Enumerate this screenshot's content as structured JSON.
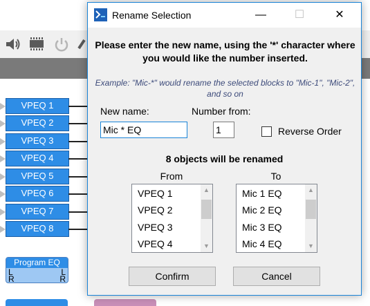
{
  "dialog": {
    "title": "Rename Selection",
    "instruction": "Please enter the new name, using the '*' character where you would like the number inserted.",
    "example": "Example: \"Mic-*\" would rename the selected blocks to \"Mic-1\", \"Mic-2\", and so on",
    "new_name_label": "New name:",
    "new_name_value": "Mic * EQ",
    "number_from_label": "Number from:",
    "number_from_value": "1",
    "reverse_order_label": "Reverse Order",
    "reverse_order_checked": false,
    "count_text": "8 objects will be renamed",
    "from_header": "From",
    "to_header": "To",
    "from_items": [
      "VPEQ 1",
      "VPEQ 2",
      "VPEQ 3",
      "VPEQ 4"
    ],
    "to_items": [
      "Mic 1 EQ",
      "Mic 2 EQ",
      "Mic 3 EQ",
      "Mic 4 EQ"
    ],
    "confirm_label": "Confirm",
    "cancel_label": "Cancel",
    "minimize_glyph": "—",
    "maximize_glyph": "☐",
    "close_glyph": "✕"
  },
  "background": {
    "blocks": [
      "VPEQ 1",
      "VPEQ 2",
      "VPEQ 3",
      "VPEQ 4",
      "VPEQ 5",
      "VPEQ 6",
      "VPEQ 7",
      "VPEQ 8"
    ],
    "program_eq": {
      "title": "Program EQ",
      "in_left": "L",
      "in_right": "R",
      "out_left": "L",
      "out_right": "R"
    },
    "toolbar_icons": [
      "speaker-icon",
      "chip-icon",
      "power-icon",
      "tool-icon"
    ]
  },
  "colors": {
    "block_fill": "#2e8de6",
    "dialog_border": "#1883d7",
    "dialog_face": "#f0f0f0",
    "example_text": "#3c4a7a"
  }
}
